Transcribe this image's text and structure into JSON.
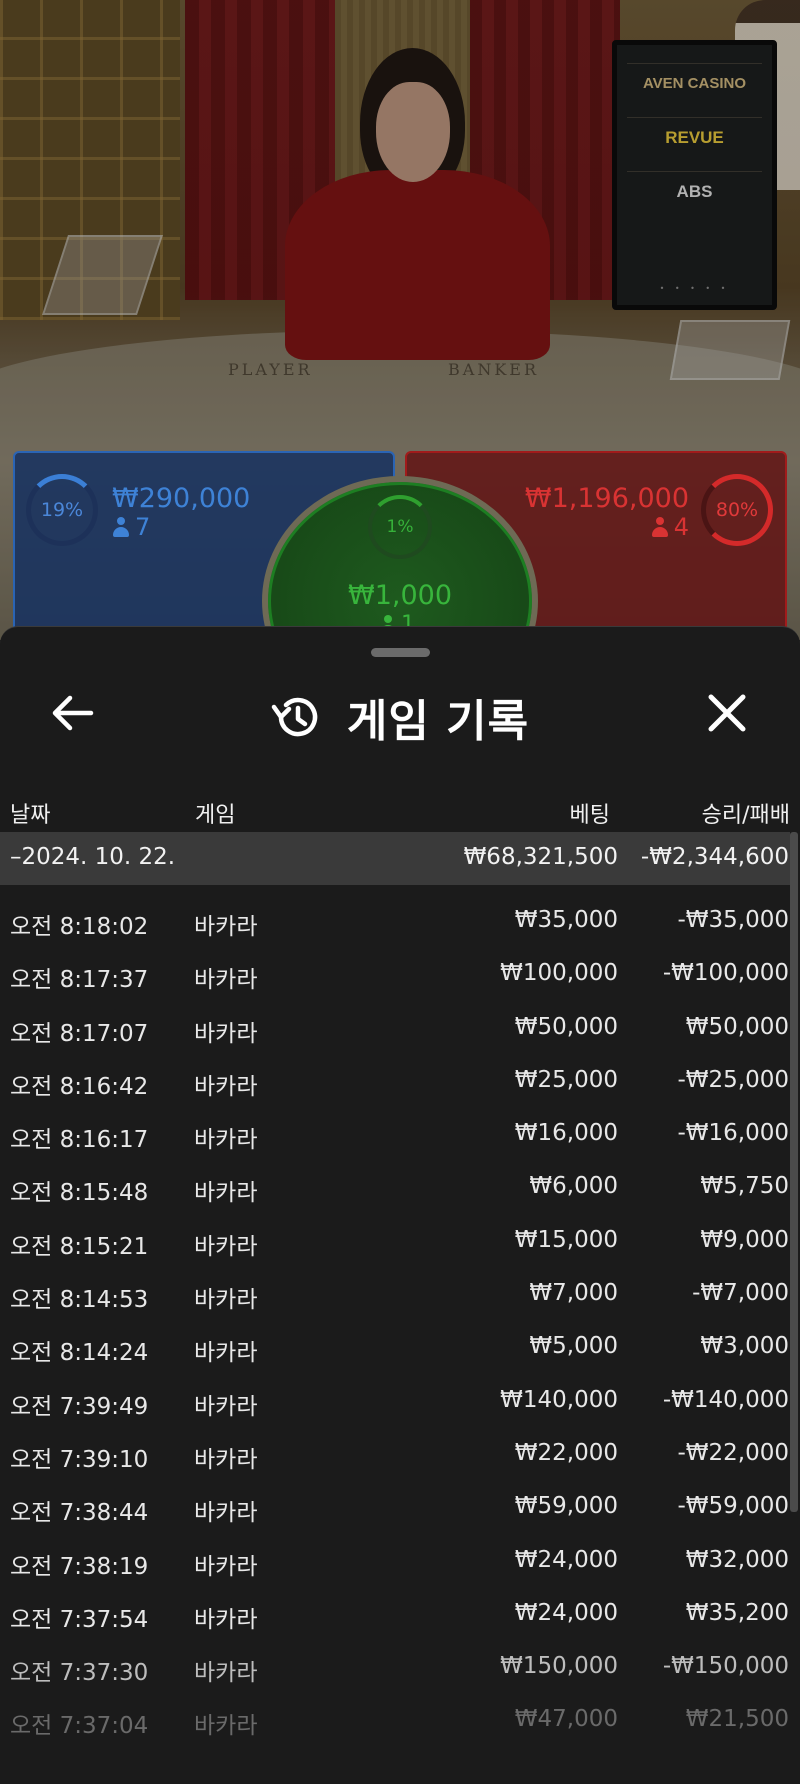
{
  "video": {
    "table_words": [
      "PLAYER",
      "BANKER"
    ],
    "sponsors": [
      "AVEN CASINO",
      "REVUE",
      "ABS"
    ],
    "board_dots": "• • • • •"
  },
  "bets": {
    "player": {
      "percent": "19%",
      "amount": "₩290,000",
      "count": "7",
      "color": "#3e82d6"
    },
    "tie": {
      "percent": "1%",
      "amount": "₩1,000",
      "count": "1",
      "color": "#38b53c"
    },
    "banker": {
      "percent": "80%",
      "amount": "₩1,196,000",
      "count": "4",
      "color": "#d93333"
    }
  },
  "sheet": {
    "title": "게임 기록",
    "back_icon": "arrow-left-icon",
    "history_icon": "history-icon",
    "close_icon": "close-icon",
    "columns": {
      "date": "날짜",
      "game": "게임",
      "bet": "베팅",
      "result": "승리/패배"
    },
    "day": {
      "date": "–2024. 10. 22.",
      "bet": "₩68,321,500",
      "result": "-₩2,344,600"
    },
    "rows": [
      {
        "time": "오전 8:18:02",
        "game": "바카라",
        "bet": "₩35,000",
        "result": "-₩35,000"
      },
      {
        "time": "오전 8:17:37",
        "game": "바카라",
        "bet": "₩100,000",
        "result": "-₩100,000"
      },
      {
        "time": "오전 8:17:07",
        "game": "바카라",
        "bet": "₩50,000",
        "result": "₩50,000"
      },
      {
        "time": "오전 8:16:42",
        "game": "바카라",
        "bet": "₩25,000",
        "result": "-₩25,000"
      },
      {
        "time": "오전 8:16:17",
        "game": "바카라",
        "bet": "₩16,000",
        "result": "-₩16,000"
      },
      {
        "time": "오전 8:15:48",
        "game": "바카라",
        "bet": "₩6,000",
        "result": "₩5,750"
      },
      {
        "time": "오전 8:15:21",
        "game": "바카라",
        "bet": "₩15,000",
        "result": "₩9,000"
      },
      {
        "time": "오전 8:14:53",
        "game": "바카라",
        "bet": "₩7,000",
        "result": "-₩7,000"
      },
      {
        "time": "오전 8:14:24",
        "game": "바카라",
        "bet": "₩5,000",
        "result": "₩3,000"
      },
      {
        "time": "오전 7:39:49",
        "game": "바카라",
        "bet": "₩140,000",
        "result": "-₩140,000"
      },
      {
        "time": "오전 7:39:10",
        "game": "바카라",
        "bet": "₩22,000",
        "result": "-₩22,000"
      },
      {
        "time": "오전 7:38:44",
        "game": "바카라",
        "bet": "₩59,000",
        "result": "-₩59,000"
      },
      {
        "time": "오전 7:38:19",
        "game": "바카라",
        "bet": "₩24,000",
        "result": "₩32,000"
      },
      {
        "time": "오전 7:37:54",
        "game": "바카라",
        "bet": "₩24,000",
        "result": "₩35,200"
      },
      {
        "time": "오전 7:37:30",
        "game": "바카라",
        "bet": "₩150,000",
        "result": "-₩150,000"
      },
      {
        "time": "오전 7:37:04",
        "game": "바카라",
        "bet": "₩47,000",
        "result": "₩21,500"
      }
    ]
  }
}
